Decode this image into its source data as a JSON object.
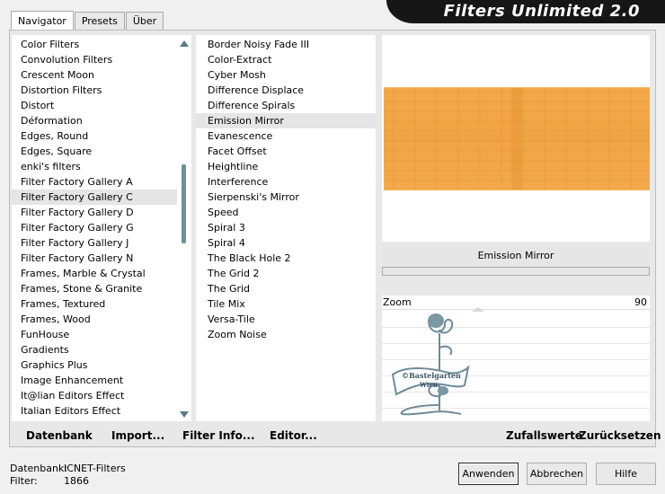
{
  "tabs": [
    {
      "label": "Navigator",
      "active": true
    },
    {
      "label": "Presets",
      "active": false
    },
    {
      "label": "Über",
      "active": false
    }
  ],
  "app_title": "Filters Unlimited 2.0",
  "categories": {
    "selected": "Filter Factory Gallery C",
    "items": [
      "Color Filters",
      "Convolution Filters",
      "Crescent Moon",
      "Distortion Filters",
      "Distort",
      "Déformation",
      "Edges, Round",
      "Edges, Square",
      "enki's filters",
      "Filter Factory Gallery A",
      "Filter Factory Gallery C",
      "Filter Factory Gallery D",
      "Filter Factory Gallery G",
      "Filter Factory Gallery J",
      "Filter Factory Gallery N",
      "Frames, Marble & Crystal",
      "Frames, Stone & Granite",
      "Frames, Textured",
      "Frames, Wood",
      "FunHouse",
      "Gradients",
      "Graphics Plus",
      "Image Enhancement",
      "It@lian Editors Effect",
      "Italian Editors Effect"
    ]
  },
  "filters": {
    "selected": "Emission Mirror",
    "items": [
      "Border Noisy Fade III",
      "Color-Extract",
      "Cyber Mosh",
      "Difference Displace",
      "Difference Spirals",
      "Emission Mirror",
      "Evanescence",
      "Facet Offset",
      "Heightline",
      "Interference",
      "Sierpenski's Mirror",
      "Speed",
      "Spiral 3",
      "Spiral 4",
      "The Black Hole 2",
      "The Grid 2",
      "The Grid",
      "Tile Mix",
      "Versa-Tile",
      "Zoom Noise"
    ]
  },
  "preview": {
    "filter_name": "Emission Mirror",
    "color": "#f2a847"
  },
  "zoom": {
    "label": "Zoom",
    "value": "90"
  },
  "watermark_text": [
    "©Bastelgarten",
    "Wien"
  ],
  "bottom_buttons": {
    "datenbank": "Datenbank",
    "import": "Import...",
    "filter_info": "Filter Info...",
    "editor": "Editor...",
    "zufallswerte": "Zufallswerte",
    "zuruecksetzen": "Zurücksetzen"
  },
  "status": {
    "db_label": "Datenbank:",
    "db_value": "ICNET-Filters",
    "filter_label": "Filter:",
    "filter_value": "1866"
  },
  "dialog_buttons": {
    "ok": "Anwenden",
    "cancel": "Abbrechen",
    "help": "Hilfe"
  }
}
